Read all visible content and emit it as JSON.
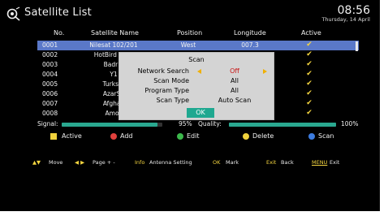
{
  "header": {
    "title": "Satellite List",
    "time": "08:56",
    "date": "Thursday, 14  April"
  },
  "columns": {
    "no": "No.",
    "name": "Satellite Name",
    "position": "Position",
    "longitude": "Longitude",
    "active": "Active"
  },
  "satellites": [
    {
      "no": "0001",
      "name": "Nilesat 102/201",
      "position": "West",
      "longitude": "007.3",
      "active": "✔"
    },
    {
      "no": "0002",
      "name": "HotBird 13°E",
      "position": "",
      "longitude": "",
      "active": "✔"
    },
    {
      "no": "0003",
      "name": "Badr 4",
      "position": "",
      "longitude": "",
      "active": "✔"
    },
    {
      "no": "0004",
      "name": "Y1",
      "position": "",
      "longitude": "",
      "active": "✔"
    },
    {
      "no": "0005",
      "name": "Turksat",
      "position": "",
      "longitude": "",
      "active": "✔"
    },
    {
      "no": "0006",
      "name": "AzarSp",
      "position": "",
      "longitude": "",
      "active": "✔"
    },
    {
      "no": "0007",
      "name": "Afghan",
      "position": "",
      "longitude": "",
      "active": "✔"
    },
    {
      "no": "0008",
      "name": "Amos",
      "position": "",
      "longitude": "",
      "active": "✔"
    }
  ],
  "signal": {
    "signal_label": "Signal:",
    "quality_label": "Quality:",
    "signal_value": "95%",
    "quality_value": "100%",
    "signal_level": 0.95,
    "quality_level": 1.0
  },
  "legend": {
    "active": "Active",
    "add": "Add",
    "edit": "Edit",
    "delete": "Delete",
    "scan": "Scan",
    "colors": {
      "yellow": "#f0d23c",
      "red": "#e0403c",
      "green": "#3cb84c",
      "blue": "#3c7ce0"
    }
  },
  "help": {
    "move": "Move",
    "page": "Page + -",
    "info_key": "Info",
    "info": "Antenna Setting",
    "ok_key": "OK",
    "ok": "Mark",
    "exit_key": "Exit",
    "exit": "Back",
    "menu_key": "MENU",
    "menu": "Exit"
  },
  "dialog": {
    "title": "Scan",
    "fields": [
      {
        "label": "Network Search",
        "value": "Off"
      },
      {
        "label": "Scan Mode",
        "value": "All"
      },
      {
        "label": "Program Type",
        "value": "All"
      },
      {
        "label": "Scan Type",
        "value": "Auto Scan"
      }
    ],
    "ok": "OK"
  }
}
